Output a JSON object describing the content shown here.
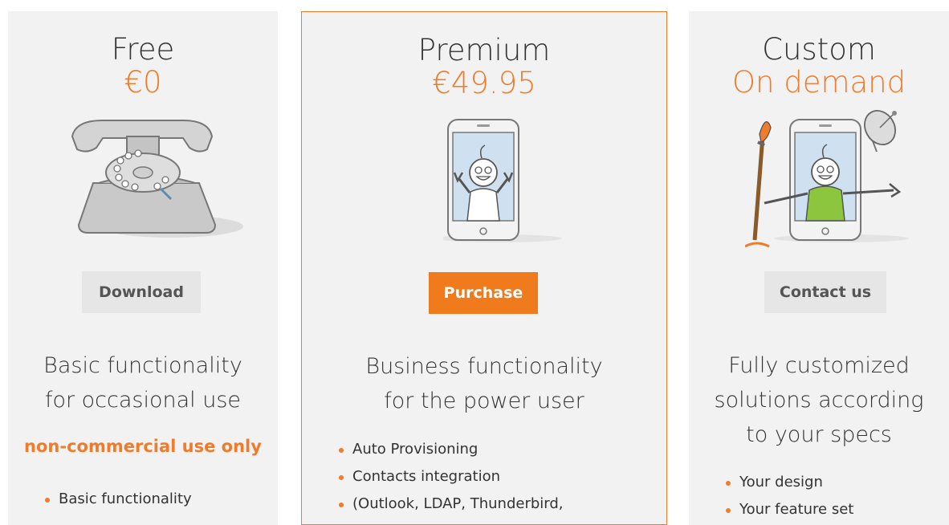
{
  "free": {
    "title": "Free",
    "price": "€0",
    "button": "Download",
    "tagline_1": "Basic functionality",
    "tagline_2": "for occasional use",
    "note": "non-commercial use only",
    "features": [
      "Basic functionality"
    ]
  },
  "premium": {
    "title": "Premium",
    "price": "€49.95",
    "button": "Purchase",
    "tagline_1": "Business functionality",
    "tagline_2": "for the power user",
    "features": [
      "Auto Provisioning",
      "Contacts integration",
      "(Outlook, LDAP, Thunderbird,"
    ]
  },
  "custom": {
    "title": "Custom",
    "price": "On demand",
    "button": "Contact us",
    "tagline_1": "Fully customized",
    "tagline_2": "solutions according",
    "tagline_3": "to your specs",
    "features": [
      "Your design",
      "Your feature set"
    ]
  },
  "colors": {
    "accent": "#ef7b2b",
    "panel": "#f2f2f2",
    "button_grey": "#e6e6e6"
  }
}
